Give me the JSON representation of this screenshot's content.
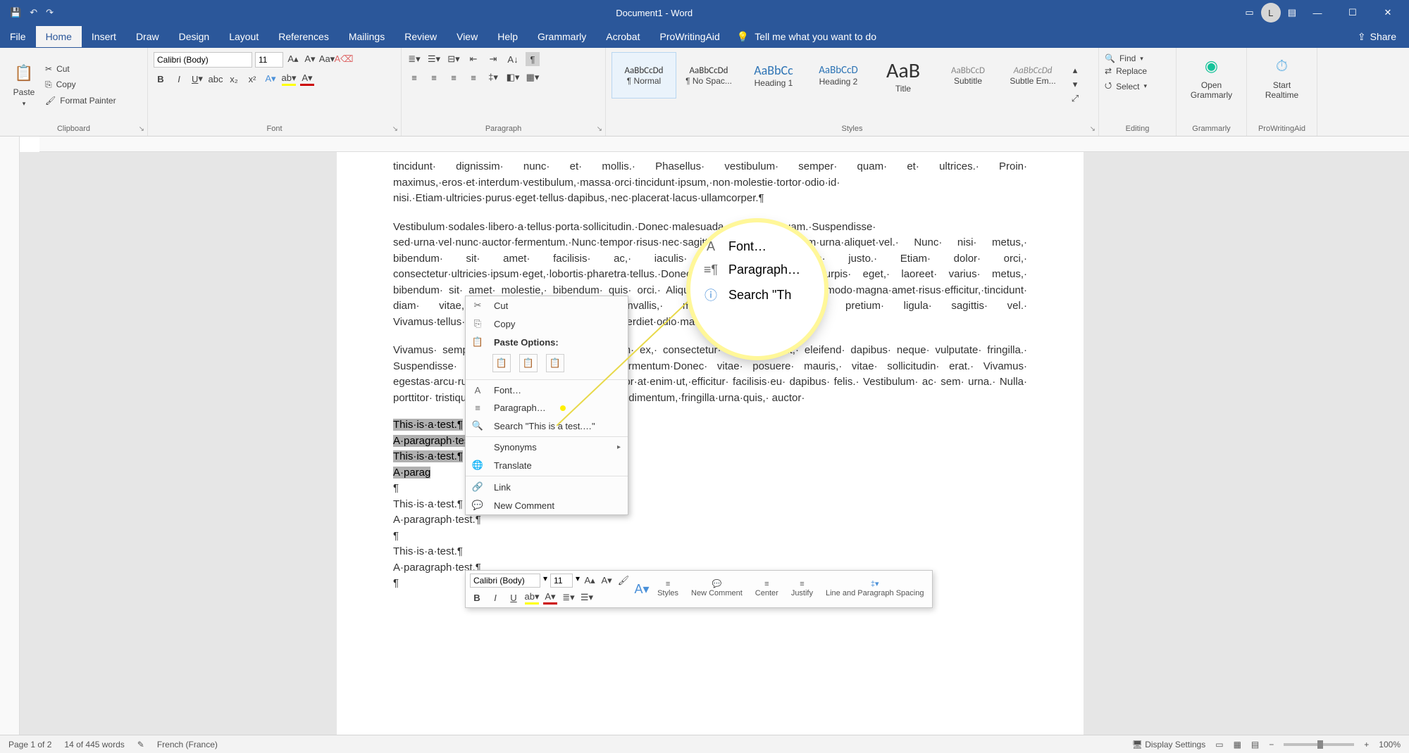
{
  "title": "Document1  -  Word",
  "avatar_initial": "L",
  "qat": {
    "undo": "↶",
    "redo": "↷",
    "save": "💾"
  },
  "tabs": [
    "File",
    "Home",
    "Insert",
    "Draw",
    "Design",
    "Layout",
    "References",
    "Mailings",
    "Review",
    "View",
    "Help",
    "Grammarly",
    "Acrobat",
    "ProWritingAid"
  ],
  "active_tab": "Home",
  "tell_me": "Tell me what you want to do",
  "share": "Share",
  "clipboard": {
    "paste": "Paste",
    "cut": "Cut",
    "copy": "Copy",
    "format_painter": "Format Painter",
    "label": "Clipboard"
  },
  "font": {
    "name": "Calibri (Body)",
    "size": "11",
    "label": "Font"
  },
  "paragraph": {
    "label": "Paragraph"
  },
  "styles": {
    "label": "Styles",
    "items": [
      {
        "prev": "AaBbCcDd",
        "name": "¶ Normal"
      },
      {
        "prev": "AaBbCcDd",
        "name": "¶ No Spac..."
      },
      {
        "prev": "AaBbCc",
        "name": "Heading 1"
      },
      {
        "prev": "AaBbCcD",
        "name": "Heading 2"
      },
      {
        "prev": "AaB",
        "name": "Title"
      },
      {
        "prev": "AaBbCcD",
        "name": "Subtitle"
      },
      {
        "prev": "AaBbCcDd",
        "name": "Subtle Em..."
      }
    ]
  },
  "editing": {
    "find": "Find",
    "replace": "Replace",
    "select": "Select",
    "label": "Editing"
  },
  "grammarly": {
    "open": "Open Grammarly",
    "label": "Grammarly"
  },
  "pwa": {
    "start": "Start Realtime",
    "label": "ProWritingAid"
  },
  "context_menu": {
    "cut": "Cut",
    "copy": "Copy",
    "paste_options": "Paste Options:",
    "font": "Font…",
    "paragraph": "Paragraph…",
    "search": "Search \"This is a test.…\"",
    "synonyms": "Synonyms",
    "translate": "Translate",
    "link": "Link",
    "new_comment": "New Comment"
  },
  "mag": {
    "font": "Font…",
    "paragraph": "Paragraph…",
    "search": "Search \"Th"
  },
  "mini": {
    "font": "Calibri (Body)",
    "size": "11",
    "styles": "Styles",
    "new_comment": "New Comment",
    "center": "Center",
    "justify": "Justify",
    "lps": "Line and Paragraph Spacing"
  },
  "status": {
    "page": "Page 1 of 2",
    "words": "14 of 445 words",
    "lang": "French (France)",
    "display": "Display Settings",
    "zoom": "100%"
  },
  "doc": {
    "p1": "tincidunt· dignissim· nunc· et· mollis.· Phasellus· vestibulum· semper· quam· et· ultrices.· Proin· maximus,·eros·et·interdum·vestibulum,·massa·orci·tincidunt·ipsum,·non·molestie·tortor·odio·id· nisi.·Etiam·ultricies·purus·eget·tellus·dapibus,·nec·placerat·lacus·ullamcorper.¶",
    "p2": "Vestibulum·sodales·libero·a·tellus·porta·sollicitudin.·Donec·malesuada·accumsan·quam.·Suspendisse· sed·urna·vel·nunc·auctor·fermentum.·Nunc·tempor·risus·nec·sagittis·euismod·at·interdum·urna·aliquet·vel.· Nunc· nisi· metus,· bibendum· sit· amet· facilisis· ac,· iaculis· id· arcu.· Etiam· justo.· Etiam· dolor· orci,· consectetur·ultricies·ipsum·eget,·lobortis·pharetra·tellus.·Donec·enim·eleifend,·scelerisque·turpis· eget,· laoreet· varius· metus,· bibendum· sit· amet· molestie,· bibendum· quis· orci.· Aliquam· varius· lacus,·eget·commodo·magna·amet·risus·efficitur,·tincidunt· diam· vitae,· scelerisque· neque· convallis,· maximus· mauris.·Aenean· pretium· ligula· sagittis· vel.· Vivamus·tellus·egestas,·tellus·auctor·Aenean·imperdiet·odio·mattis·nulla·auctor·posuere.¶",
    "p3": "Vivamus· semper· lacinia· risus.·Vivamus· lorem· ex,· consectetur· in· rutrum· ut,· eleifend· dapibus· neque· vulputate· fringilla.· Suspendisse· et· elit· at· ante· suscipit· fermentum·Donec· vitae· posuere· mauris,· vitae· sollicitudin· erat.· Vivamus· egestas·arcu·rutrum·congue.·Proin·felis·ex,·tempor·at·enim·ut,·efficitur· facilisis·eu· dapibus· felis.· Vestibulum· ac· sem· urna.· Nulla· porttitor· tristique·scelerisque·sed.·Sed·at·orci·condimentum,·fringilla·urna·quis,· auctor·",
    "t1": "This·is·a·test.¶",
    "t2": "A·paragraph·test.¶",
    "t3": "This·is·a·test.¶",
    "t4": "A·parag",
    "t5": "¶",
    "t6": "This·is·a·test.¶",
    "t7": "A·paragraph·test.¶",
    "t8": "¶",
    "t9": "This·is·a·test.¶",
    "t10": "A·paragraph·test.¶",
    "t11": "¶"
  }
}
